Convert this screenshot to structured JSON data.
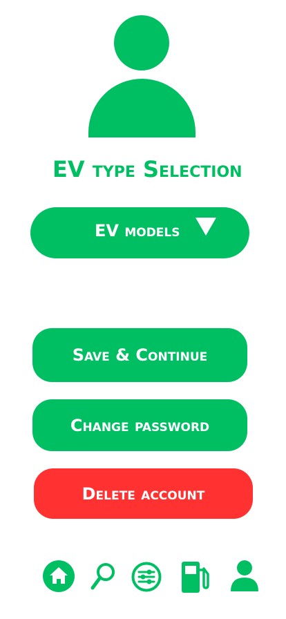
{
  "profile": {
    "avatar_icon": "user-avatar-icon"
  },
  "page": {
    "title": "EV type Selection"
  },
  "dropdown": {
    "label": "EV models",
    "icon": "caret-down-icon"
  },
  "actions": {
    "save_label": "Save & Continue",
    "change_password_label": "Change password",
    "delete_account_label": "Delete account"
  },
  "bottom_nav": {
    "items": [
      {
        "icon": "home-icon"
      },
      {
        "icon": "search-icon"
      },
      {
        "icon": "settings-sliders-icon"
      },
      {
        "icon": "fuel-pump-icon"
      },
      {
        "icon": "profile-icon"
      }
    ]
  },
  "colors": {
    "accent": "#00bf63",
    "danger": "#ff3131",
    "background": "#ffffff",
    "text_on_button": "#ffffff"
  }
}
